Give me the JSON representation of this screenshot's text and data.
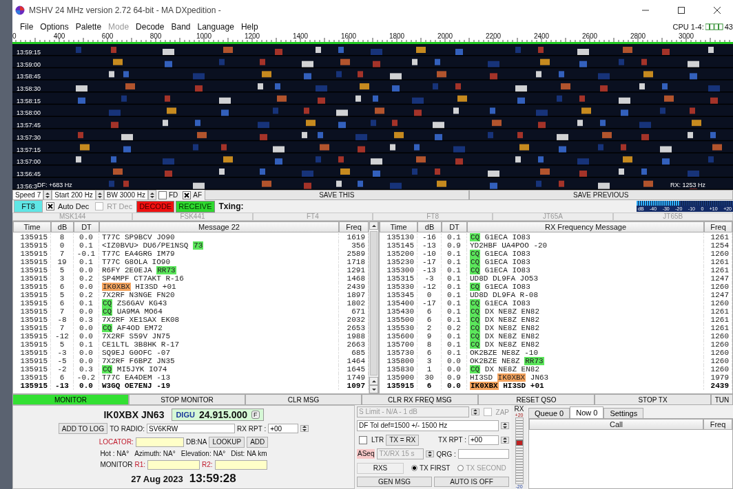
{
  "window": {
    "title": "MSHV 24 MHz version 2.72 64-bit  - MA DXpedition -"
  },
  "menu": [
    {
      "label": "File",
      "disabled": false
    },
    {
      "label": "Options",
      "disabled": false
    },
    {
      "label": "Palette",
      "disabled": false
    },
    {
      "label": "Mode",
      "disabled": true
    },
    {
      "label": "Decode",
      "disabled": false
    },
    {
      "label": "Band",
      "disabled": false
    },
    {
      "label": "Language",
      "disabled": false
    },
    {
      "label": "Help",
      "disabled": false
    }
  ],
  "cpu": {
    "label": "CPU 1-4:",
    "value": "43"
  },
  "ruler": [
    "0",
    "400",
    "600",
    "800",
    "1000",
    "1200",
    "1400",
    "1600",
    "1800",
    "2000",
    "2200",
    "2400",
    "2600",
    "2800",
    "3000"
  ],
  "waterfall": {
    "times": [
      "13:59:15",
      "13:59:00",
      "13:58:45",
      "13:58:30",
      "13:58:15",
      "13:58:00",
      "13:57:45",
      "13:57:30",
      "13:57:15",
      "13:57:00",
      "13:56:45",
      "13:56:3"
    ],
    "df": "DF: +683 Hz",
    "rx": "RX: 1253 Hz"
  },
  "controls": {
    "speed": "Speed 7",
    "start": "Start 200 Hz",
    "bw": "BW 3000 Hz",
    "checks": [
      {
        "label": "FD",
        "checked": false
      },
      {
        "label": "AF",
        "checked": true
      }
    ],
    "save_this": "SAVE THIS",
    "save_previous": "SAVE PREVIOUS"
  },
  "decode_bar": {
    "mode": "FT8",
    "checks": [
      {
        "label": "Auto Dec",
        "checked": true,
        "disabled": false
      },
      {
        "label": "RT Dec",
        "checked": false,
        "disabled": true
      }
    ],
    "decode": "DECODE",
    "receive": "RECEIVE",
    "txing": "Txing:",
    "meter": {
      "level": 0.45,
      "scale": [
        "dB",
        "-40",
        "-30",
        "-20",
        "-10",
        "0",
        "+10",
        "+20"
      ]
    }
  },
  "mode_tabs": [
    {
      "label": "MSK144",
      "disabled": true
    },
    {
      "label": "FSK441",
      "disabled": true
    },
    {
      "label": "FT4",
      "disabled": true
    },
    {
      "label": "FT8",
      "disabled": true
    },
    {
      "label": "JT65A",
      "disabled": true
    },
    {
      "label": "JT65B",
      "disabled": true
    }
  ],
  "decode_table": {
    "columns": [
      "Time",
      "dB",
      "DT",
      "Message 22",
      "Freq"
    ],
    "rows": [
      {
        "time": "135915",
        "db": "8",
        "dt": "0.0",
        "message": [
          {
            "text": "T77C SP9BCV JO90"
          }
        ],
        "freq": "1619",
        "bold": false
      },
      {
        "time": "135915",
        "db": "0",
        "dt": "0.1",
        "message": [
          {
            "text": "<IZ0BVU> DU6/PE1NSQ "
          },
          {
            "text": "73",
            "color": "#5be65b"
          }
        ],
        "freq": "356",
        "bold": false
      },
      {
        "time": "135915",
        "db": "7",
        "dt": "-0.1",
        "message": [
          {
            "text": "T77C EA4GRG IM79"
          }
        ],
        "freq": "2589",
        "bold": false
      },
      {
        "time": "135915",
        "db": "19",
        "dt": "0.1",
        "message": [
          {
            "text": "T77C G8OLA IO90"
          }
        ],
        "freq": "1718",
        "bold": false
      },
      {
        "time": "135915",
        "db": "5",
        "dt": "0.0",
        "message": [
          {
            "text": "R6FY 2E0EJA "
          },
          {
            "text": "RR73",
            "color": "#5be65b"
          }
        ],
        "freq": "1291",
        "bold": false
      },
      {
        "time": "135915",
        "db": "3",
        "dt": "0.2",
        "message": [
          {
            "text": "SP4MPF CT7AKT R-16"
          }
        ],
        "freq": "1468",
        "bold": false
      },
      {
        "time": "135915",
        "db": "6",
        "dt": "0.0",
        "message": [
          {
            "text": "IK0XBX",
            "color": "#f5a45e"
          },
          {
            "text": " HI3SD +01"
          }
        ],
        "freq": "2439",
        "bold": false
      },
      {
        "time": "135915",
        "db": "5",
        "dt": "0.2",
        "message": [
          {
            "text": "7X2RF N3NGE FN20"
          }
        ],
        "freq": "1897",
        "bold": false
      },
      {
        "time": "135915",
        "db": "6",
        "dt": "0.1",
        "message": [
          {
            "text": "CQ",
            "color": "#5be65b"
          },
          {
            "text": " ZS6GAV KG43"
          }
        ],
        "freq": "1802",
        "bold": false
      },
      {
        "time": "135915",
        "db": "7",
        "dt": "0.0",
        "message": [
          {
            "text": "CQ",
            "color": "#5be65b"
          },
          {
            "text": " UA9MA MO64"
          }
        ],
        "freq": "671",
        "bold": false
      },
      {
        "time": "135915",
        "db": "-8",
        "dt": "0.3",
        "message": [
          {
            "text": "7X2RF XE1SAX EK08"
          }
        ],
        "freq": "2032",
        "bold": false
      },
      {
        "time": "135915",
        "db": "7",
        "dt": "0.0",
        "message": [
          {
            "text": "CQ",
            "color": "#5be65b"
          },
          {
            "text": " AF4OD EM72"
          }
        ],
        "freq": "2653",
        "bold": false
      },
      {
        "time": "135915",
        "db": "-12",
        "dt": "0.0",
        "message": [
          {
            "text": "7X2RF S59V JN75"
          }
        ],
        "freq": "1988",
        "bold": false
      },
      {
        "time": "135915",
        "db": "5",
        "dt": "0.1",
        "message": [
          {
            "text": "CE1LTL 3B8HK R-17"
          }
        ],
        "freq": "2663",
        "bold": false
      },
      {
        "time": "135915",
        "db": "-3",
        "dt": "0.0",
        "message": [
          {
            "text": "SQ9EJ G0OFC -07"
          }
        ],
        "freq": "685",
        "bold": false
      },
      {
        "time": "135915",
        "db": "-5",
        "dt": "0.0",
        "message": [
          {
            "text": "7X2RF F6BPZ JN35"
          }
        ],
        "freq": "1464",
        "bold": false
      },
      {
        "time": "135915",
        "db": "-2",
        "dt": "0.3",
        "message": [
          {
            "text": "CQ",
            "color": "#5be65b"
          },
          {
            "text": " MI5JYK IO74"
          }
        ],
        "freq": "1645",
        "bold": false
      },
      {
        "time": "135915",
        "db": "6",
        "dt": "-0.2",
        "message": [
          {
            "text": "T77C EA4DEM -13"
          }
        ],
        "freq": "1749",
        "bold": false
      },
      {
        "time": "135915",
        "db": "-13",
        "dt": "0.0",
        "message": [
          {
            "text": "W3GQ OE7ENJ -19"
          }
        ],
        "freq": "1097",
        "bold": true
      }
    ]
  },
  "rx_table": {
    "columns": [
      "Time",
      "dB",
      "DT",
      "RX Frequency Message",
      "Freq"
    ],
    "rows": [
      {
        "time": "135130",
        "db": "-16",
        "dt": "0.1",
        "message": [
          {
            "text": "CQ",
            "color": "#5be65b"
          },
          {
            "text": " G1ECA IO83"
          }
        ],
        "freq": "1261",
        "bold": false
      },
      {
        "time": "135145",
        "db": "-13",
        "dt": "0.9",
        "message": [
          {
            "text": "YD2HBF UA4POO -20"
          }
        ],
        "freq": "1254",
        "bold": false
      },
      {
        "time": "135200",
        "db": "-10",
        "dt": "0.1",
        "message": [
          {
            "text": "CQ",
            "color": "#5be65b"
          },
          {
            "text": " G1ECA IO83"
          }
        ],
        "freq": "1260",
        "bold": false
      },
      {
        "time": "135230",
        "db": "-17",
        "dt": "0.1",
        "message": [
          {
            "text": "CQ",
            "color": "#5be65b"
          },
          {
            "text": " G1ECA IO83"
          }
        ],
        "freq": "1261",
        "bold": false
      },
      {
        "time": "135300",
        "db": "-13",
        "dt": "0.1",
        "message": [
          {
            "text": "CQ",
            "color": "#5be65b"
          },
          {
            "text": " G1ECA IO83"
          }
        ],
        "freq": "1261",
        "bold": false
      },
      {
        "time": "135315",
        "db": "-3",
        "dt": "0.1",
        "message": [
          {
            "text": "UD8D DL9FA JO53"
          }
        ],
        "freq": "1247",
        "bold": false
      },
      {
        "time": "135330",
        "db": "-12",
        "dt": "0.1",
        "message": [
          {
            "text": "CQ",
            "color": "#5be65b"
          },
          {
            "text": " G1ECA IO83"
          }
        ],
        "freq": "1260",
        "bold": false
      },
      {
        "time": "135345",
        "db": "0",
        "dt": "0.1",
        "message": [
          {
            "text": "UD8D DL9FA R-08"
          }
        ],
        "freq": "1247",
        "bold": false
      },
      {
        "time": "135400",
        "db": "-17",
        "dt": "0.1",
        "message": [
          {
            "text": "CQ",
            "color": "#5be65b"
          },
          {
            "text": " G1ECA IO83"
          }
        ],
        "freq": "1260",
        "bold": false
      },
      {
        "time": "135430",
        "db": "6",
        "dt": "0.1",
        "message": [
          {
            "text": "CQ",
            "color": "#5be65b"
          },
          {
            "text": " DX NE8Z EN82"
          }
        ],
        "freq": "1261",
        "bold": false
      },
      {
        "time": "135500",
        "db": "6",
        "dt": "0.1",
        "message": [
          {
            "text": "CQ",
            "color": "#5be65b"
          },
          {
            "text": " DX NE8Z EN82"
          }
        ],
        "freq": "1261",
        "bold": false
      },
      {
        "time": "135530",
        "db": "2",
        "dt": "0.2",
        "message": [
          {
            "text": "CQ",
            "color": "#5be65b"
          },
          {
            "text": " DX NE8Z EN82"
          }
        ],
        "freq": "1261",
        "bold": false
      },
      {
        "time": "135600",
        "db": "9",
        "dt": "0.1",
        "message": [
          {
            "text": "CQ",
            "color": "#5be65b"
          },
          {
            "text": " DX NE8Z EN82"
          }
        ],
        "freq": "1260",
        "bold": false
      },
      {
        "time": "135700",
        "db": "8",
        "dt": "0.1",
        "message": [
          {
            "text": "CQ",
            "color": "#5be65b"
          },
          {
            "text": " DX NE8Z EN82"
          }
        ],
        "freq": "1260",
        "bold": false
      },
      {
        "time": "135730",
        "db": "6",
        "dt": "0.1",
        "message": [
          {
            "text": "OK2BZE NE8Z -10"
          }
        ],
        "freq": "1260",
        "bold": false
      },
      {
        "time": "135800",
        "db": "3",
        "dt": "0.0",
        "message": [
          {
            "text": "OK2BZE NE8Z "
          },
          {
            "text": "RR73",
            "color": "#5be65b"
          }
        ],
        "freq": "1260",
        "bold": false
      },
      {
        "time": "135830",
        "db": "1",
        "dt": "0.0",
        "message": [
          {
            "text": "CQ",
            "color": "#5be65b"
          },
          {
            "text": " DX NE8Z EN82"
          }
        ],
        "freq": "1260",
        "bold": false
      },
      {
        "time": "135900",
        "db": "30",
        "dt": "0.9",
        "message": [
          {
            "text": "HI3SD "
          },
          {
            "text": "IK0XBX",
            "color": "#f5a45e"
          },
          {
            "text": " JN63"
          }
        ],
        "freq": "1979",
        "bold": false
      },
      {
        "time": "135915",
        "db": "6",
        "dt": "0.0",
        "message": [
          {
            "text": "IK0XBX",
            "color": "#f5a45e"
          },
          {
            "text": " HI3SD +01"
          }
        ],
        "freq": "2439",
        "bold": true
      }
    ]
  },
  "actions": [
    {
      "label": "MONITOR",
      "on": true
    },
    {
      "label": "STOP MONITOR",
      "on": false
    },
    {
      "label": "CLR MSG",
      "on": false
    },
    {
      "label": "CLR RX FREQ MSG",
      "on": false
    },
    {
      "label": "RESET QSO",
      "on": false
    },
    {
      "label": "STOP TX",
      "on": false
    },
    {
      "label": "TUN",
      "on": false
    }
  ],
  "station": {
    "call": "IK0XBX JN63",
    "mode": "DIGU",
    "freq": "24.915.000",
    "f_button": "F",
    "add_to_log": "ADD TO LOG",
    "to_radio_label": "TO RADIO:",
    "to_radio": "SV6KRW",
    "rx_rpt_label": "RX RPT :",
    "rx_rpt": "+00",
    "locator_label": "LOCATOR:",
    "db": "DB:NA",
    "lookup": "LOOKUP",
    "add": "ADD",
    "info": [
      "Hot : NA°",
      "Azimuth: NA°",
      "Elevation: NA°",
      "Dist: NA km"
    ],
    "monitor_label": "MONITOR",
    "r1_label": "R1:",
    "r2_label": "R2:",
    "date": "27 Aug 2023",
    "time": "13:59:28"
  },
  "settings": {
    "s_limit": "S Limit - N/A - 1  dB",
    "zap": {
      "label": "ZAP",
      "checked": false
    },
    "df_tol": "DF Tol def=1500 +/-  1500  Hz",
    "ltr": {
      "label": "LTR",
      "checked": false
    },
    "tx_rx": "TX = RX",
    "tx_rpt_label": "TX RPT :",
    "tx_rpt": "+00",
    "aseq": "ASeq",
    "txrx_period": "TX/RX 15  s",
    "qrg_label": "QRG :",
    "rxs": "RXS",
    "radios": [
      {
        "label": "TX FIRST",
        "selected": true
      },
      {
        "label": "TX SECOND",
        "selected": false
      }
    ],
    "gen_msg": "GEN MSG",
    "auto": "AUTO IS OFF"
  },
  "rx_gain": {
    "label": "RX",
    "max": "+20",
    "min": "-20",
    "level": 0.62
  },
  "queue": {
    "tabs": [
      {
        "label": "Queue 0",
        "selected": false
      },
      {
        "label": "Now 0",
        "selected": true
      },
      {
        "label": "Settings",
        "selected": false
      }
    ],
    "columns": [
      "Call",
      "Freq"
    ]
  }
}
